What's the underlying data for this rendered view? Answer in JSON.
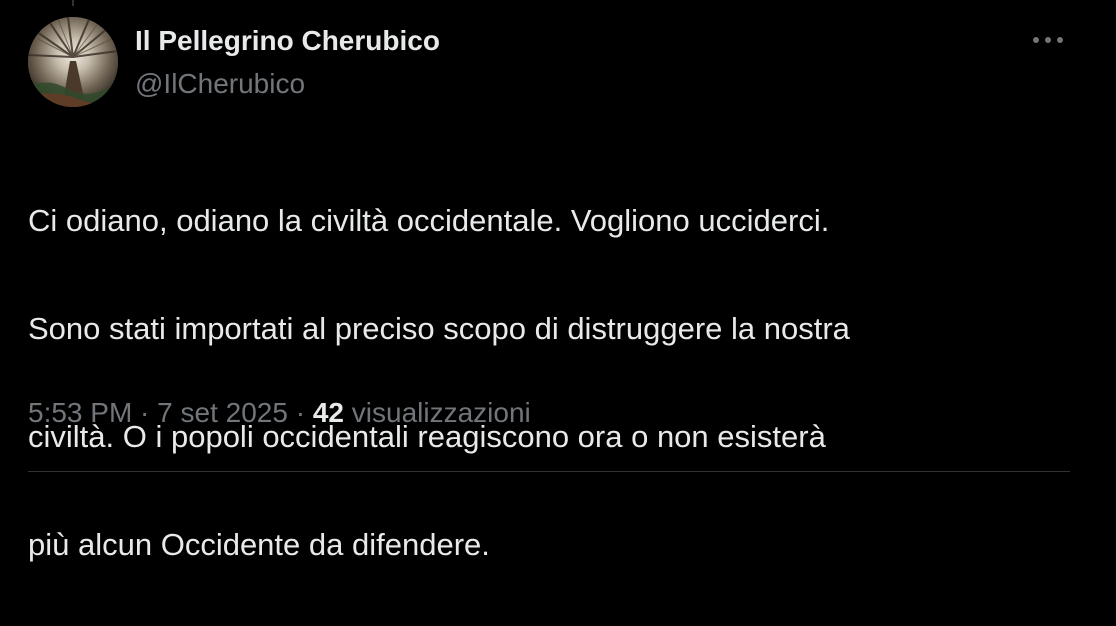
{
  "author": {
    "display_name": "Il Pellegrino Cherubico",
    "handle": "@IlCherubico"
  },
  "tweet": {
    "text_lines": [
      "Ci odiano, odiano la civiltà occidentale. Vogliono ucciderci.",
      "Sono stati importati al preciso scopo di distruggere la nostra",
      "civiltà. O i popoli occidentali reagiscono ora o non esisterà",
      "più alcun Occidente da difendere."
    ]
  },
  "meta": {
    "time": "5:53 PM",
    "separator": " · ",
    "date": "7 set 2025",
    "views_count": "42",
    "views_label": "visualizzazioni"
  },
  "icons": {
    "more": "more-horizontal-icon",
    "avatar": "forest-canopy-avatar"
  },
  "colors": {
    "background": "#000000",
    "primary_text": "#e7e9ea",
    "secondary_text": "#71767b",
    "divider": "#2f3336"
  }
}
